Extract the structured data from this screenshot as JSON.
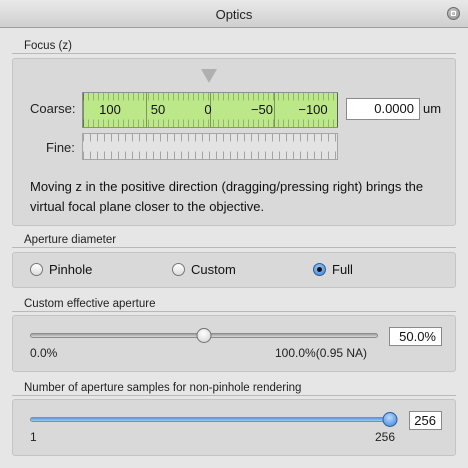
{
  "window": {
    "title": "Optics"
  },
  "focus": {
    "label": "Focus (z)",
    "coarse_label": "Coarse:",
    "fine_label": "Fine:",
    "tick_labels": [
      "100",
      "50",
      "0",
      "−50",
      "−100"
    ],
    "value": "0.0000",
    "unit": "um",
    "description": "Moving z in the positive direction (dragging/pressing right) brings the virtual focal plane closer to the objective.",
    "ruler_color": "#bde88a"
  },
  "aperture": {
    "label": "Aperture diameter",
    "options": [
      "Pinhole",
      "Custom",
      "Full"
    ],
    "selected": "Full"
  },
  "custom_aperture": {
    "label": "Custom effective aperture",
    "min_label": "0.0%",
    "max_label": "100.0%(0.95 NA)",
    "value": "50.0%",
    "fraction": 0.5
  },
  "samples": {
    "label": "Number of aperture samples for non-pinhole rendering",
    "min_label": "1",
    "max_label": "256",
    "value": "256",
    "fraction": 1.0
  },
  "icons": {
    "window_button": "window-toggle-icon",
    "slider_thumb": "slider-thumb-icon"
  }
}
